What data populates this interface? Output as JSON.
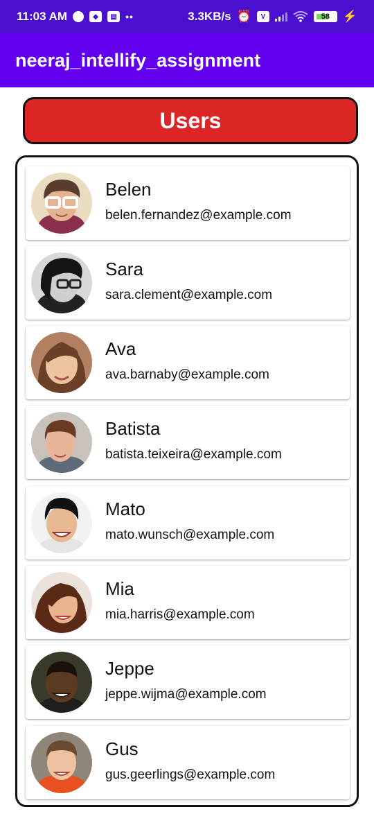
{
  "status_bar": {
    "time": "11:03 AM",
    "speed": "3.3KB/s",
    "battery": "58",
    "icons": [
      "data-saver-icon",
      "notification-icon",
      "news-icon",
      "more-dots-icon",
      "alarm-icon",
      "volte-icon",
      "signal-icon",
      "wifi-icon",
      "battery-icon",
      "charging-icon"
    ]
  },
  "app_bar": {
    "title": "neeraj_intellify_assignment"
  },
  "banner": {
    "label": "Users",
    "color": "#dc2626"
  },
  "colors": {
    "status_bar": "#4a0fcf",
    "app_bar": "#6200ee"
  },
  "users": [
    {
      "name": "Belen",
      "email": "belen.fernandez@example.com"
    },
    {
      "name": "Sara",
      "email": "sara.clement@example.com"
    },
    {
      "name": "Ava",
      "email": "ava.barnaby@example.com"
    },
    {
      "name": "Batista",
      "email": "batista.teixeira@example.com"
    },
    {
      "name": "Mato",
      "email": "mato.wunsch@example.com"
    },
    {
      "name": "Mia",
      "email": "mia.harris@example.com"
    },
    {
      "name": "Jeppe",
      "email": "jeppe.wijma@example.com"
    },
    {
      "name": "Gus",
      "email": "gus.geerlings@example.com"
    }
  ]
}
